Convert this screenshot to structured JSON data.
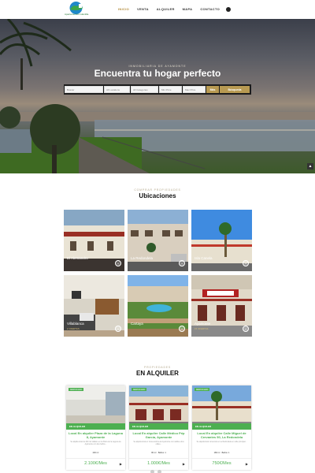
{
  "header": {
    "logo_text": "Apartamentos Islantilla",
    "nav": [
      "INICIO",
      "VENTA",
      "ALQUILER",
      "MAPA",
      "CONTACTO"
    ]
  },
  "hero": {
    "kicker": "INMOBILIARIA DE AYAMONTE",
    "title": "Encuentra tu hogar perfecto",
    "search": {
      "keyword_placeholder": "Buscar",
      "location": "All Locations",
      "category": "All Categories",
      "price_min": "Min Price",
      "price_max": "Max Price",
      "filter_button": "Más",
      "search_button": "Búsqueda"
    }
  },
  "locations": {
    "kicker": "COMPRAR PROPIEDADES",
    "title": "Ubicaciones",
    "items": [
      {
        "name": "El Alemandro",
        "sub": ""
      },
      {
        "name": "La Redondela",
        "sub": ""
      },
      {
        "name": "Isla Canela",
        "sub": ""
      },
      {
        "name": "Villablanca",
        "sub": "2 OFERTAS"
      },
      {
        "name": "Cartaya",
        "sub": ""
      },
      {
        "name": "Ayamonte",
        "sub": "15 OFERTAS"
      }
    ]
  },
  "rentals": {
    "kicker": "PROPIEDADES",
    "title": "EN ALQUILER",
    "cards": [
      {
        "badge": "DESTACADO",
        "status": "EN ALQUILER",
        "title": "Local En alquiler Plaza de la Laguna 8, Ayamonte",
        "desc": "Se alquila local de 200 m2 diáfano en la Plaza de la Laguna de Ayamonte con dos baños...",
        "meta": "200 m²",
        "price": "2.100€/Mes"
      },
      {
        "badge": "DESTACADO",
        "status": "EN ALQUILER",
        "title": "Local En alquiler Calle Médico Pép García, Ayamonte",
        "desc": "Se alquila local en zona céntrica de Ayamonte con salida a dos calles...",
        "meta": "80 m²  ·  Baños: 1",
        "price": "1.000€/Mes"
      },
      {
        "badge": "DESTACADO",
        "status": "EN ALQUILER",
        "title": "Local En alquiler Calle Miguel de Cervantes 50, La Redondela",
        "desc": "Se alquila local comercial en La Redondela en calle principal...",
        "meta": "180 m²  ·  Baños: 1",
        "price": "750€/Mes"
      }
    ]
  },
  "colors": {
    "accent_gold": "#b89a52",
    "accent_green": "#4caf50"
  }
}
